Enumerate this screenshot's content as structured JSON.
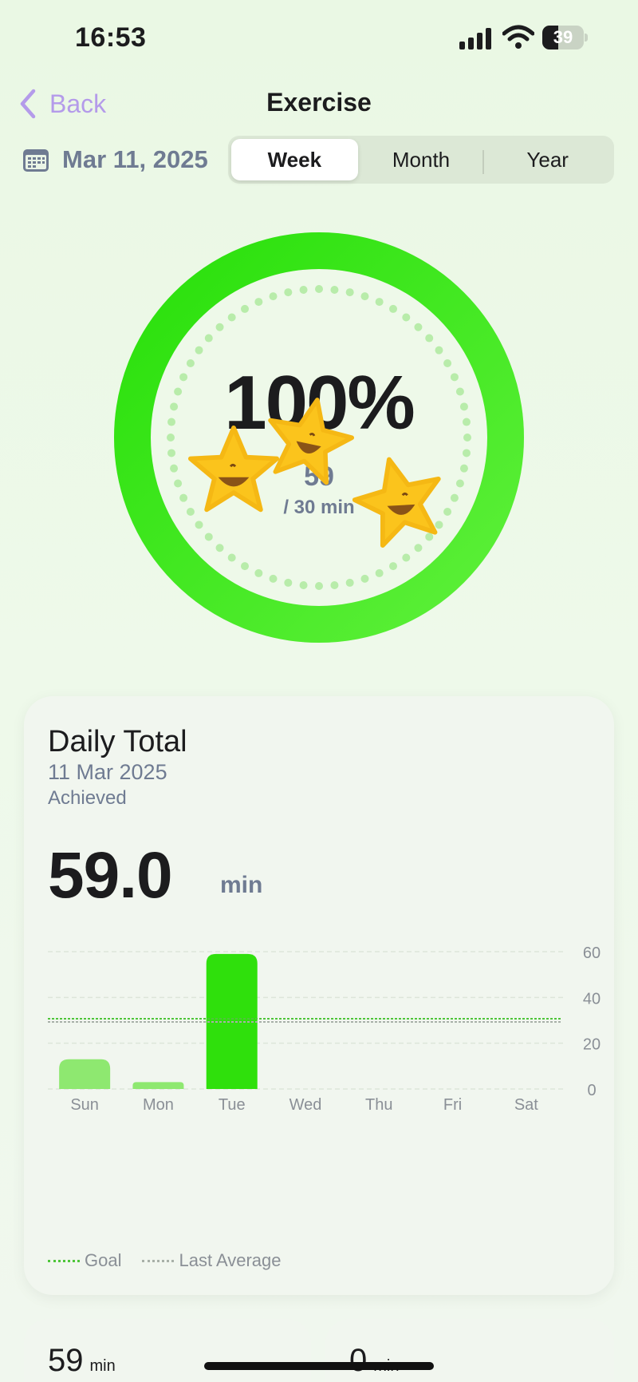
{
  "status_bar": {
    "time": "16:53",
    "battery": "39",
    "battery_level": 0.39,
    "signal_icon": "cellular-signal-icon",
    "wifi_icon": "wifi-icon",
    "battery_icon": "battery-icon"
  },
  "nav": {
    "back_label": "Back",
    "title": "Exercise"
  },
  "date_picker": {
    "label": "Mar 11, 2025",
    "icon": "calendar-icon"
  },
  "range_tabs": {
    "items": [
      "Week",
      "Month",
      "Year"
    ],
    "selected": "Week"
  },
  "ring": {
    "percent": "100%",
    "value": "59",
    "goal": "/ 30 min",
    "progress": 1.0,
    "color": "#34e01e",
    "decorations": "star-mascot-icon"
  },
  "daily_card": {
    "title": "Daily Total",
    "date": "11 Mar 2025",
    "status": "Achieved",
    "value": "59.0",
    "unit": "min"
  },
  "chart_data": {
    "type": "bar",
    "categories": [
      "Sun",
      "Mon",
      "Tue",
      "Wed",
      "Thu",
      "Fri",
      "Sat"
    ],
    "values": [
      13,
      3,
      59,
      0,
      0,
      0,
      0
    ],
    "highlight_index": 2,
    "ylim": [
      0,
      60
    ],
    "yticks": [
      "0",
      "20",
      "40",
      "60"
    ],
    "goal": 30,
    "last_average": 30,
    "colors": {
      "bar": "#8ee870",
      "bar_selected": "#2fe00c",
      "goal": "#4ec53a",
      "average": "#a8b0a8"
    },
    "legend": [
      "Goal",
      "Last Average"
    ],
    "legend_position": "bottom-left",
    "grid": true
  },
  "summary_cards": [
    {
      "value": "59",
      "unit": "min"
    },
    {
      "value": "0",
      "unit": "min"
    }
  ]
}
